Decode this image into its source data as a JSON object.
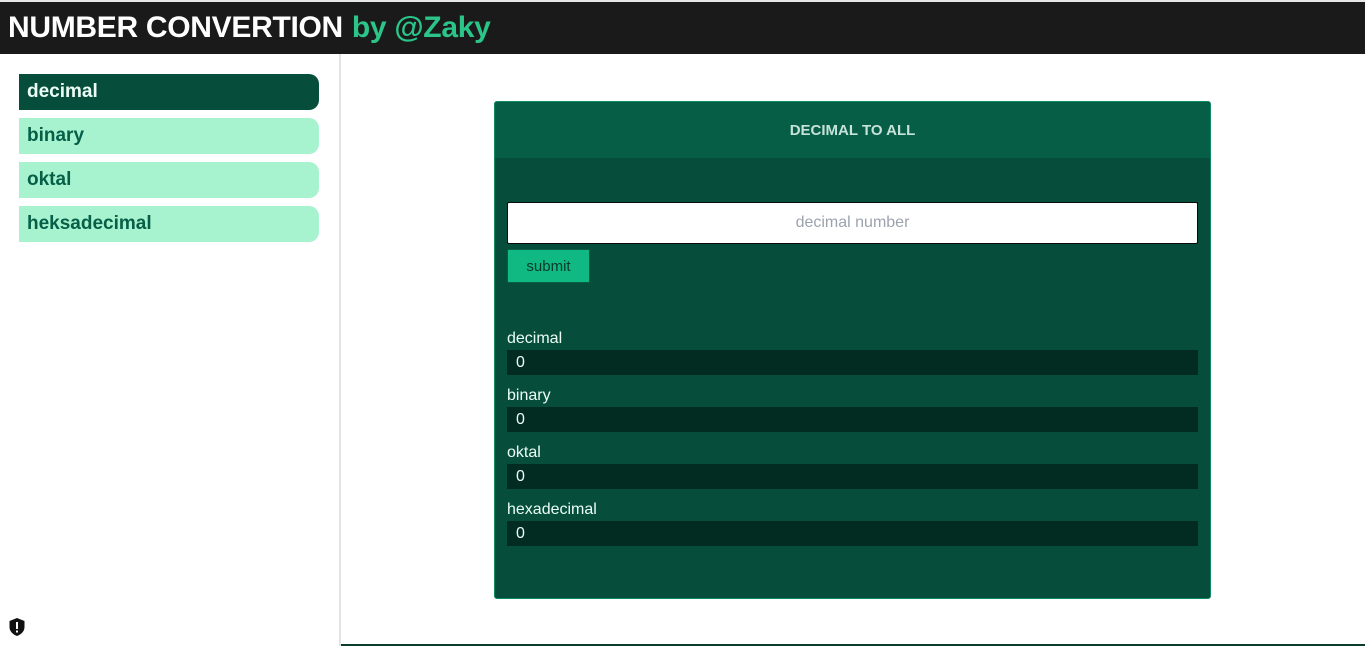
{
  "header": {
    "title": "NUMBER CONVERTION",
    "author": "by @Zaky"
  },
  "sidebar": {
    "items": [
      {
        "label": "decimal",
        "active": true
      },
      {
        "label": "binary",
        "active": false
      },
      {
        "label": "oktal",
        "active": false
      },
      {
        "label": "heksadecimal",
        "active": false
      }
    ]
  },
  "card": {
    "title": "DECIMAL TO ALL",
    "input_placeholder": "decimal number",
    "input_value": "",
    "submit_label": "submit",
    "results": [
      {
        "label": "decimal",
        "value": "0"
      },
      {
        "label": "binary",
        "value": "0"
      },
      {
        "label": "oktal",
        "value": "0"
      },
      {
        "label": "hexadecimal",
        "value": "0"
      }
    ]
  },
  "icons": {
    "extension": "shield-icon"
  },
  "colors": {
    "header_bg": "#1a1a1a",
    "accent": "#2bc489",
    "nav_active": "#064e3b",
    "nav_inactive": "#a7f3d0",
    "card_bg": "#064e3b",
    "card_header": "#075e47",
    "result_bg": "#022c22",
    "button": "#10b981"
  }
}
